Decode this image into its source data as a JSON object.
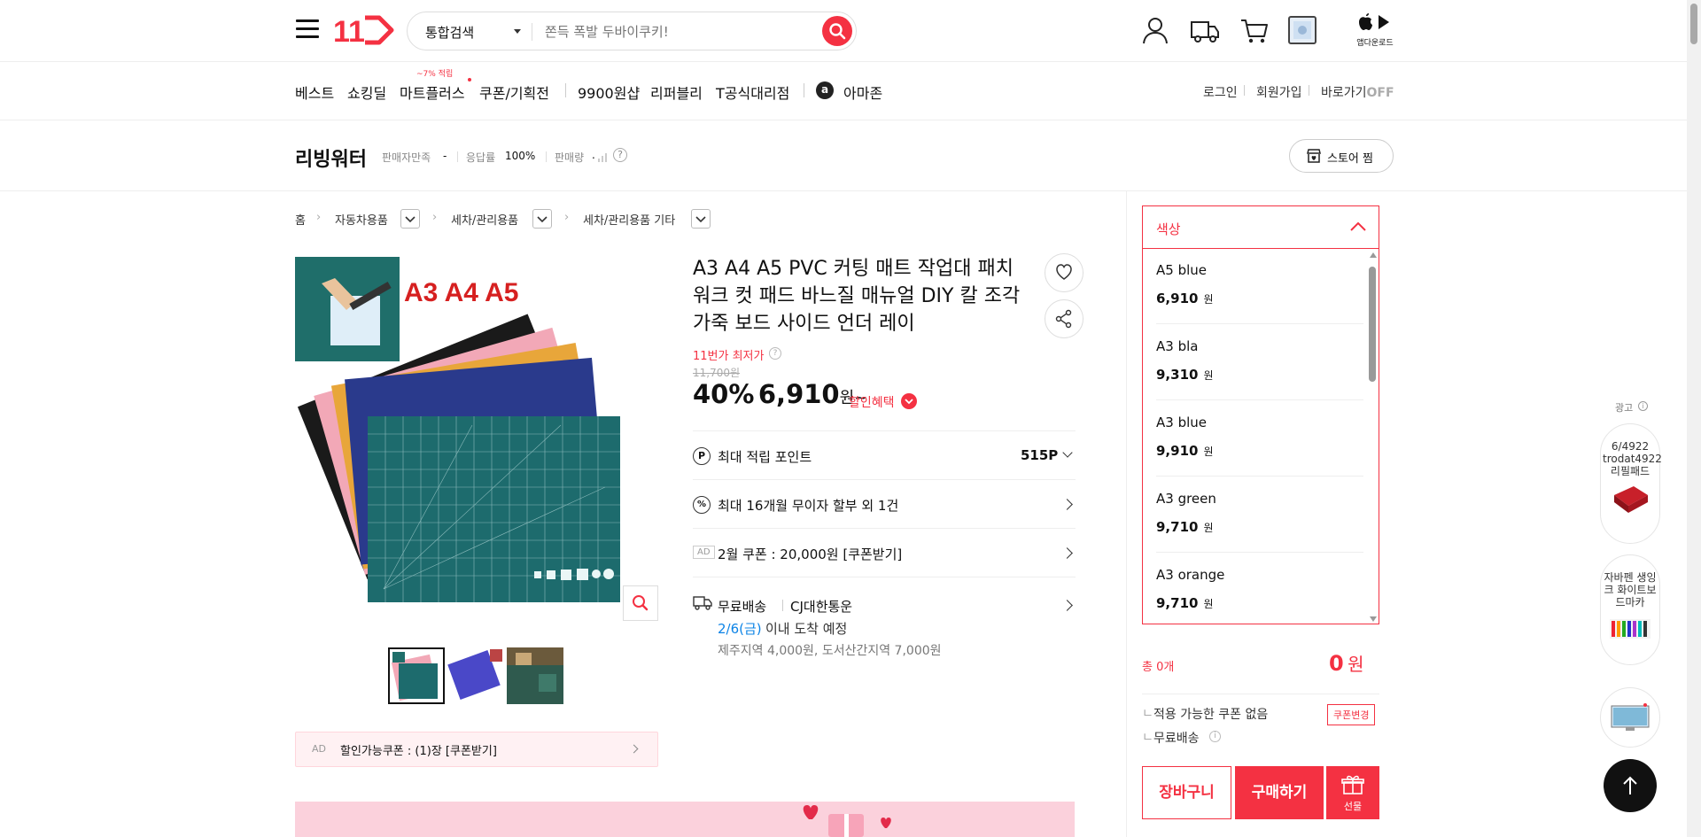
{
  "header": {
    "search_category": "통합검색",
    "search_placeholder": "쫀득 폭발 두바이쿠키!",
    "app_download": "앱다운로드"
  },
  "nav": {
    "items": [
      "베스트",
      "쇼킹딜",
      "마트플러스",
      "쿠폰/기획전",
      "9900원샵",
      "리퍼블리",
      "T공식대리점",
      "아마존"
    ],
    "mart_badge": "~7% 적립",
    "amazon_letter": "a",
    "right": [
      "로그인",
      "회원가입",
      "바로가기"
    ],
    "off": "OFF"
  },
  "store": {
    "name": "리빙워터",
    "satisfaction_label": "판매자만족",
    "satisfaction_value": "-",
    "response_label": "응답률",
    "response_value": "100%",
    "sales_label": "판매량",
    "sales_value": ".",
    "follow_label": "스토어 찜"
  },
  "breadcrumb": [
    "홈",
    "자동차용품",
    "세차/관리용품",
    "세차/관리용품 기타"
  ],
  "product": {
    "image_label": "A3 A4 A5",
    "title": "A3 A4 A5 PVC 커팅 매트 작업대 패치 워크 컷 패드 바느질 매뉴얼 DIY 칼 조각 가죽 보드 사이드 언더 레이",
    "lowest": "11번가 최저가",
    "original_price": "11,700원",
    "discount": "40%",
    "price": "6,910",
    "price_unit": "원~",
    "benefit": "할인혜택",
    "point_label": "최대 적립 포인트",
    "point_value": "515P",
    "installment": "최대 16개월 무이자 할부 외 1건",
    "ad_tag": "AD",
    "coupon_row": "2월 쿠폰 : 20,000원 [쿠폰받기]",
    "shipping_free": "무료배송",
    "shipping_carrier": "CJ대한통운",
    "arrival_date": "2/6(금)",
    "arrival_text": "이내 도착 예정",
    "extra_fee": "제주지역 4,000원, 도서산간지역 7,000원",
    "coupon_banner_ad": "AD",
    "coupon_banner": "할인가능쿠폰 : (1)장 [쿠폰받기]"
  },
  "options": {
    "header": "색상",
    "items": [
      {
        "name": "A5 blue",
        "price": "6,910",
        "unit": "원"
      },
      {
        "name": "A3 bla",
        "price": "9,310",
        "unit": "원"
      },
      {
        "name": "A3 blue",
        "price": "9,910",
        "unit": "원"
      },
      {
        "name": "A3 green",
        "price": "9,710",
        "unit": "원"
      },
      {
        "name": "A3 orange",
        "price": "9,710",
        "unit": "원"
      }
    ],
    "total_label": "총 0개",
    "total_price": "0",
    "total_unit": "원",
    "no_coupon": "적용 가능한 쿠폰 없음",
    "coupon_change": "쿠폰변경",
    "free_shipping": "무료배송",
    "cart_button": "장바구니",
    "buy_button": "구매하기",
    "gift_button": "선물"
  },
  "ads": {
    "label": "광고",
    "card1": "6/4922 trodat4922 리필패드",
    "card2": "자바펜 생잉크 화이트보드마카"
  },
  "colors": {
    "brand": "#f43142",
    "link": "#0b83e6"
  }
}
